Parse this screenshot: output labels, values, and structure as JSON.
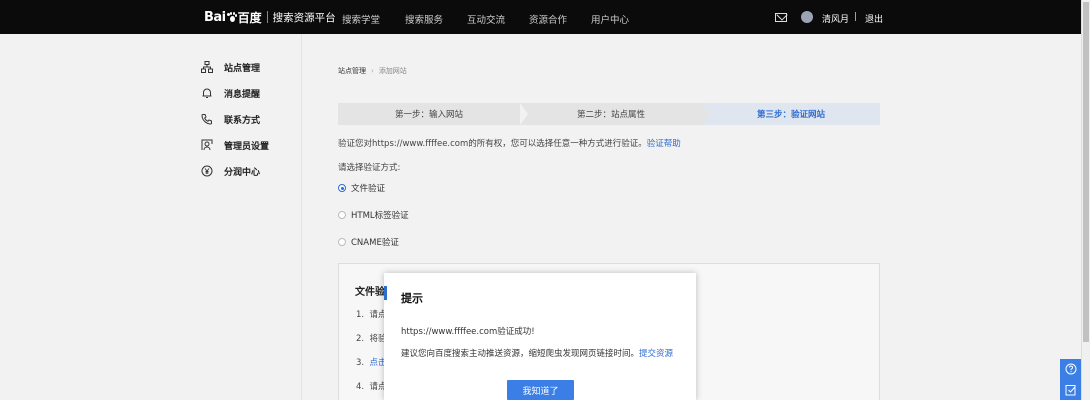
{
  "header": {
    "logo_text_en": "Bai",
    "logo_text_cn": "百度",
    "platform_title": "搜索资源平台",
    "nav": [
      {
        "label": "搜索学堂"
      },
      {
        "label": "搜索服务"
      },
      {
        "label": "互动交流"
      },
      {
        "label": "资源合作"
      },
      {
        "label": "用户中心"
      }
    ],
    "username": "清风月",
    "divider": "|",
    "logout_label": "退出"
  },
  "sidebar": {
    "items": [
      {
        "label": "站点管理",
        "icon": "sitemap-icon"
      },
      {
        "label": "消息提醒",
        "icon": "bell-icon"
      },
      {
        "label": "联系方式",
        "icon": "phone-icon"
      },
      {
        "label": "管理员设置",
        "icon": "admin-icon"
      },
      {
        "label": "分润中心",
        "icon": "yen-icon"
      }
    ]
  },
  "breadcrumb": {
    "root": "站点管理",
    "separator": "›",
    "current": "添加网站"
  },
  "steps": [
    {
      "label": "第一步：输入网站",
      "active": false
    },
    {
      "label": "第二步：站点属性",
      "active": false
    },
    {
      "label": "第三步：验证网站",
      "active": true
    }
  ],
  "verify": {
    "text": "验证您对https://www.ffffee.com的所有权，您可以选择任意一种方式进行验证。",
    "help_link": "验证帮助",
    "choose_label": "请选择验证方式:",
    "options": [
      {
        "label": "文件验证",
        "selected": true
      },
      {
        "label": "HTML标签验证",
        "selected": false
      },
      {
        "label": "CNAME验证",
        "selected": false
      }
    ]
  },
  "method_box": {
    "title": "文件验",
    "steps": [
      {
        "num": "1.",
        "text": "请点"
      },
      {
        "num": "2.",
        "text": "将验"
      },
      {
        "num": "3.",
        "text": "点击"
      },
      {
        "num": "4.",
        "text": "请点"
      }
    ]
  },
  "modal": {
    "title": "提示",
    "line1": "https://www.ffffee.com验证成功!",
    "line2": "建议您向百度搜索主动推送资源，缩短爬虫发现网页链接时间。",
    "line2_link": "提交资源",
    "confirm_label": "我知道了"
  },
  "colors": {
    "accent": "#2f6cd0",
    "button": "#3a7ee6",
    "topbar": "#0b0b0b"
  }
}
